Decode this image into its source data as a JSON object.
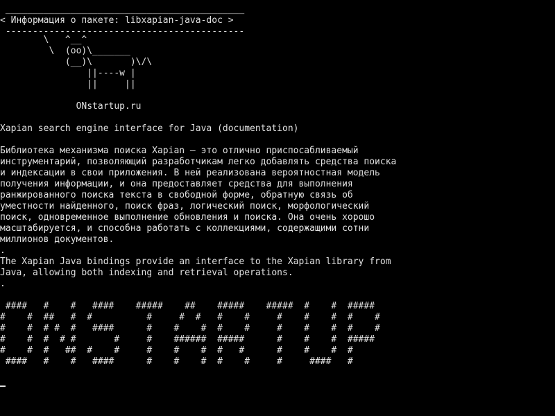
{
  "terminal": {
    "colors": {
      "background": "#000000",
      "foreground": "#e0e0e0"
    },
    "speech_bubble": [
      " ____________________________________________",
      "< Информация о пакете: libxapian-java-doc >",
      " --------------------------------------------"
    ],
    "cow": [
      "        \\   ^__^",
      "         \\  (oo)\\_______",
      "            (__)\\       )\\/\\",
      "                ||----w |",
      "                ||     ||"
    ],
    "site": "              ONstartup.ru",
    "summary": "Xapian search engine interface for Java (documentation)",
    "description_ru": [
      "Библиотека механизма поиска Xapian — это отлично приспосабливаемый",
      "инструментарий, позволяющий разработчикам легко добавлять средства поиска",
      "и индексации в свои приложения. В ней реализована вероятностная модель",
      "получения информации, и она предоставляет средства для выполнения",
      "ранжированного поиска текста в свободной форме, обратную связь об",
      "уместности найденного, поиск фраз, логический поиск, морфологический",
      "поиск, одновременное выполнение обновления и поиска. Она очень хорошо",
      "масштабируется, и способна работать с коллекциями, содержащими сотни",
      "миллионов документов.",
      "."
    ],
    "description_en": [
      "The Xapian Java bindings provide an interface to the Xapian library from",
      "Java, allowing both indexing and retrieval operations.",
      "."
    ],
    "banner": [
      " ####   #    #   ####    #####    ##    #####    #####  #    #  #####",
      "#    #  ##   #  #          #     #  #   #    #     #    #    #  #    #",
      "#    #  # #  #   ####      #    #    #  #    #     #    #    #  #    #",
      "#    #  #  # #       #     #    ######  #####      #    #    #  #####",
      "#    #  #   ##  #    #     #    #    #  #   #      #    #    #  #",
      " ####   #    #   ####      #    #    #  #    #     #     ####   #"
    ]
  }
}
